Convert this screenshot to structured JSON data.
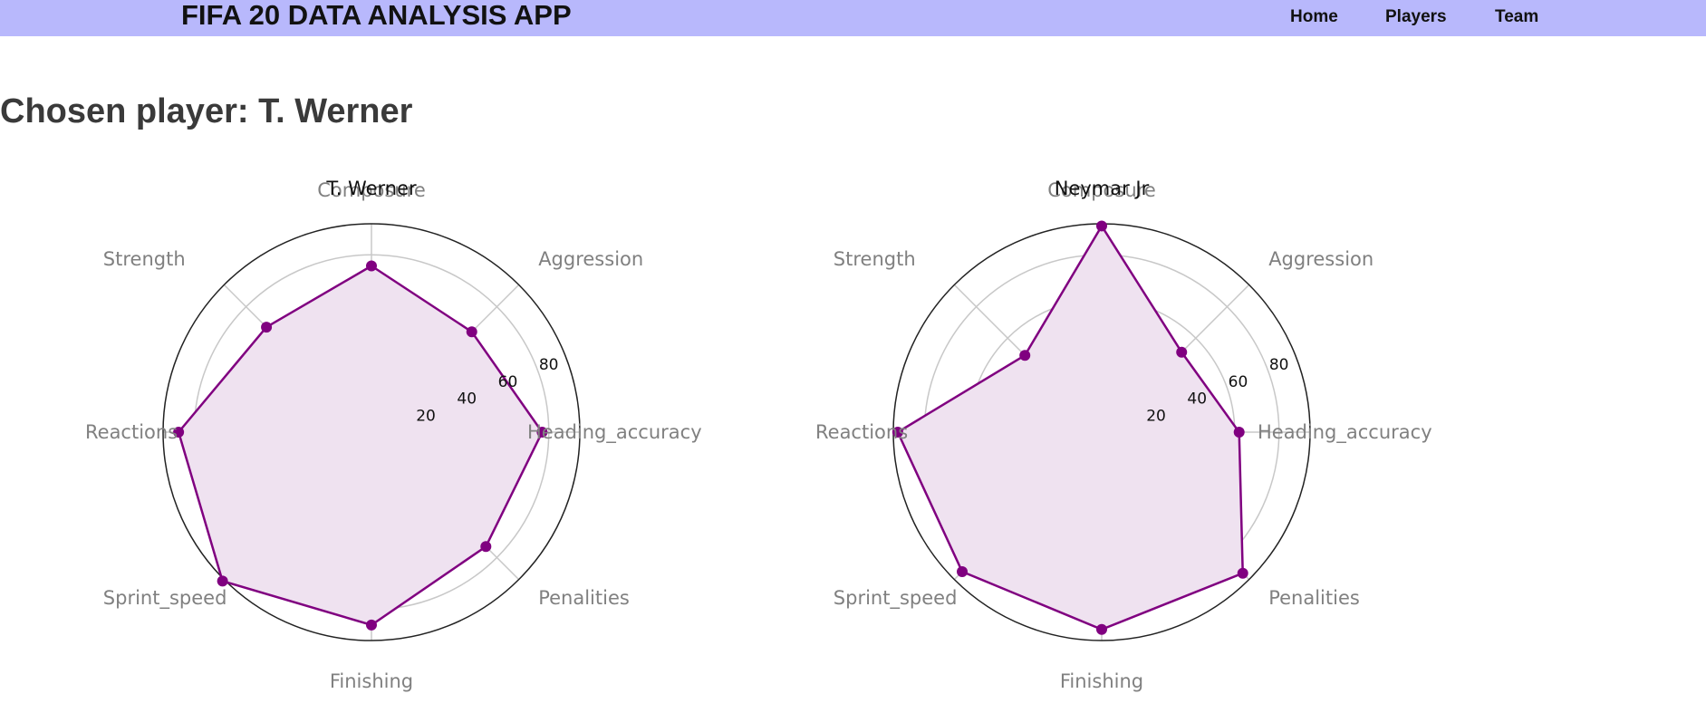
{
  "header": {
    "app_title": "FIFA 20 DATA ANALYSIS APP",
    "nav": [
      {
        "label": "Home"
      },
      {
        "label": "Players"
      },
      {
        "label": "Team"
      }
    ],
    "background_color": "#b8b8fc"
  },
  "main": {
    "heading": "Chosen player: T. Werner"
  },
  "chart_data": [
    {
      "type": "radar",
      "title": "T. Werner",
      "axes": [
        "Composure",
        "Aggression",
        "Heading_accuracy",
        "Penalities",
        "Finishing",
        "Sprint_speed",
        "Reactions",
        "Strength"
      ],
      "series": [
        {
          "values": [
            75,
            64,
            77,
            73,
            87,
            95,
            87,
            67
          ]
        }
      ],
      "rlim": [
        0,
        94
      ],
      "rticks": [
        20,
        40,
        60,
        80
      ],
      "grid": true,
      "color": "#800080",
      "fill_color": "#efe2f0"
    },
    {
      "type": "radar",
      "title": "Neymar Jr",
      "axes": [
        "Composure",
        "Aggression",
        "Heading_accuracy",
        "Penalities",
        "Finishing",
        "Sprint_speed",
        "Reactions",
        "Strength"
      ],
      "series": [
        {
          "values": [
            93,
            51,
            62,
            90,
            89,
            89,
            92,
            49
          ]
        }
      ],
      "rlim": [
        0,
        94
      ],
      "rticks": [
        20,
        40,
        60,
        80
      ],
      "grid": true,
      "color": "#800080",
      "fill_color": "#efe2f0"
    }
  ]
}
